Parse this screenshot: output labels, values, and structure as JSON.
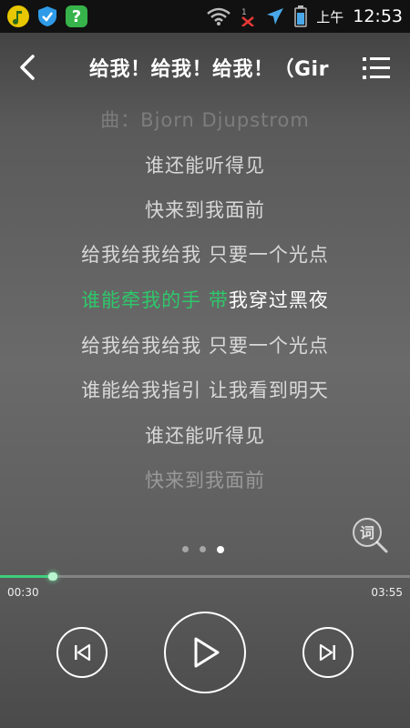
{
  "status_bar": {
    "icons": [
      "music-app-icon",
      "shield-app-icon",
      "help-app-icon"
    ],
    "right_icons": [
      "wifi-icon",
      "signal-off-icon",
      "airplane-icon",
      "battery-icon"
    ],
    "ampm": "上午",
    "time": "12:53"
  },
  "header": {
    "title": "给我！给我！给我！（Gir"
  },
  "lyrics": [
    {
      "text": "曲：Bjorn Djupstrom"
    },
    {
      "text": "谁还能听得见"
    },
    {
      "text": "快来到我面前"
    },
    {
      "text": "给我给我给我 只要一个光点"
    },
    {
      "sung": "谁能牵我的手 带",
      "unsung": "我穿过黑夜"
    },
    {
      "text": "给我给我给我 只要一个光点"
    },
    {
      "text": "谁能给我指引 让我看到明天"
    },
    {
      "text": "谁还能听得见"
    },
    {
      "text": "快来到我面前"
    }
  ],
  "lyric_search_label": "词",
  "pager": {
    "count": 3,
    "active_index": 2
  },
  "progress": {
    "elapsed": "00:30",
    "total": "03:55",
    "fraction": 0.128
  },
  "colors": {
    "accent": "#2ec86a",
    "statusbar": "#111111"
  }
}
